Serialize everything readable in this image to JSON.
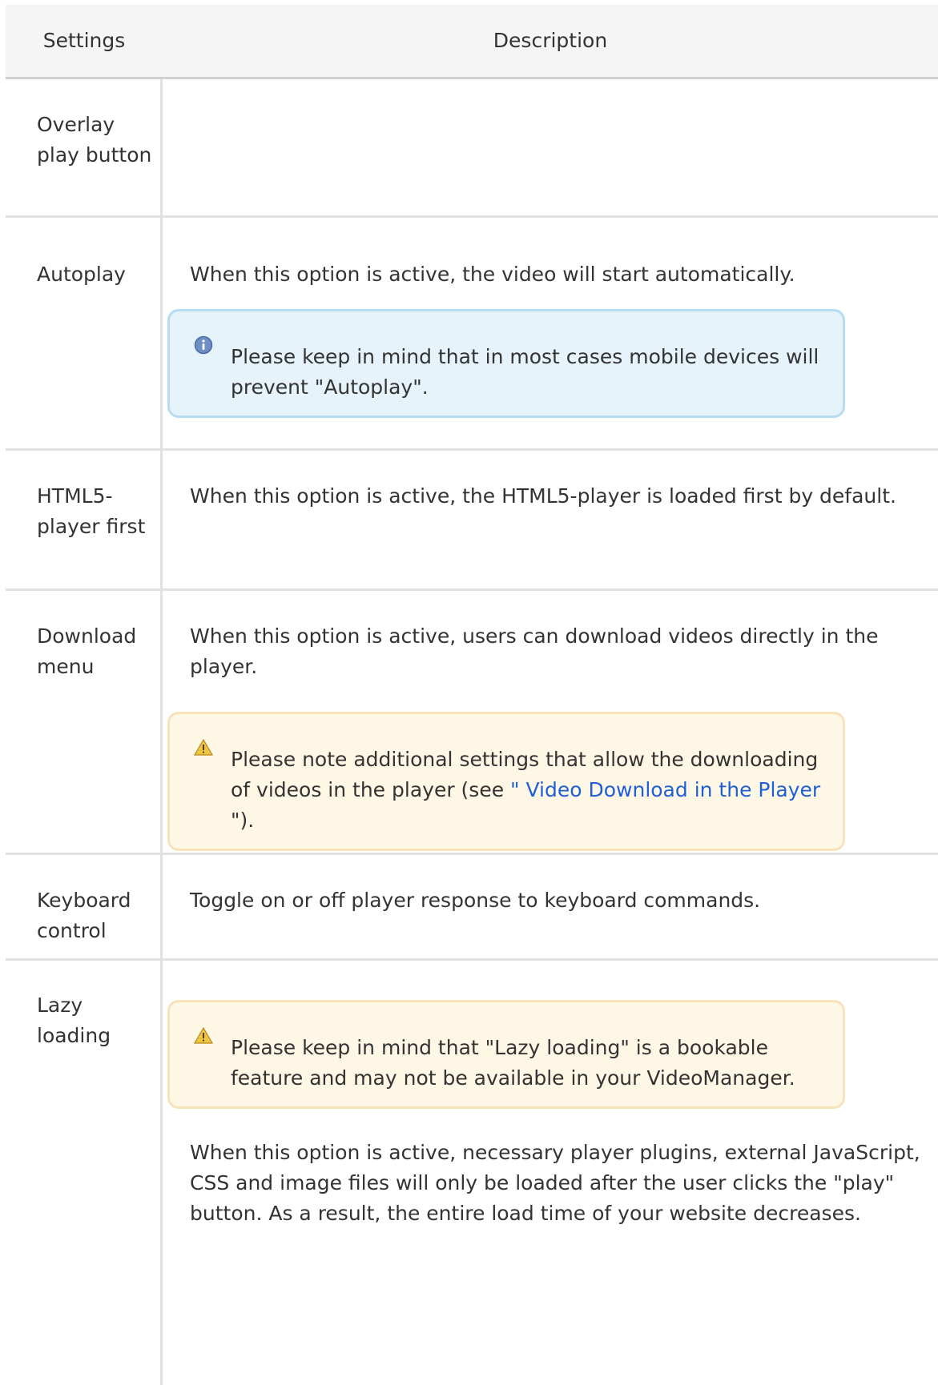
{
  "table": {
    "headers": {
      "settings": "Settings",
      "description": "Description"
    },
    "rows": [
      {
        "setting": "Overlay play button"
      },
      {
        "setting": "Autoplay",
        "description": "When this option is active, the video will start automatically.",
        "note": {
          "icon": "info-icon",
          "text": "Please keep in mind that in most cases mobile devices will prevent \"Autoplay\"."
        }
      },
      {
        "setting": "HTML5-player first",
        "description": "When this option is active, the HTML5-player is loaded first by default."
      },
      {
        "setting": "Download menu",
        "description": "When this option is active, users can download videos directly in the player.",
        "note": {
          "icon": "warning-icon",
          "text_before": "Please note additional settings that allow the downloading of videos in the player (see ",
          "link_text": "\" Video Download in the Player",
          "text_after": " \")."
        }
      },
      {
        "setting": "Keyboard control",
        "description": "Toggle on or off player response to keyboard commands."
      },
      {
        "setting": "Lazy loading",
        "note": {
          "icon": "warning-icon",
          "text": "Please keep in mind that \"Lazy loading\" is a bookable feature and may not be available in your VideoManager."
        },
        "description": "When this option is active, necessary player plugins, external JavaScript, CSS and image files will only be loaded after the user clicks the \"play\" button. As a result, the entire load time of your website decreases."
      }
    ]
  },
  "colors": {
    "info_background": "#e6f3fb",
    "warning_background": "#fff7e6",
    "link": "#1f5fd6",
    "header_background": "#f5f5f5"
  }
}
